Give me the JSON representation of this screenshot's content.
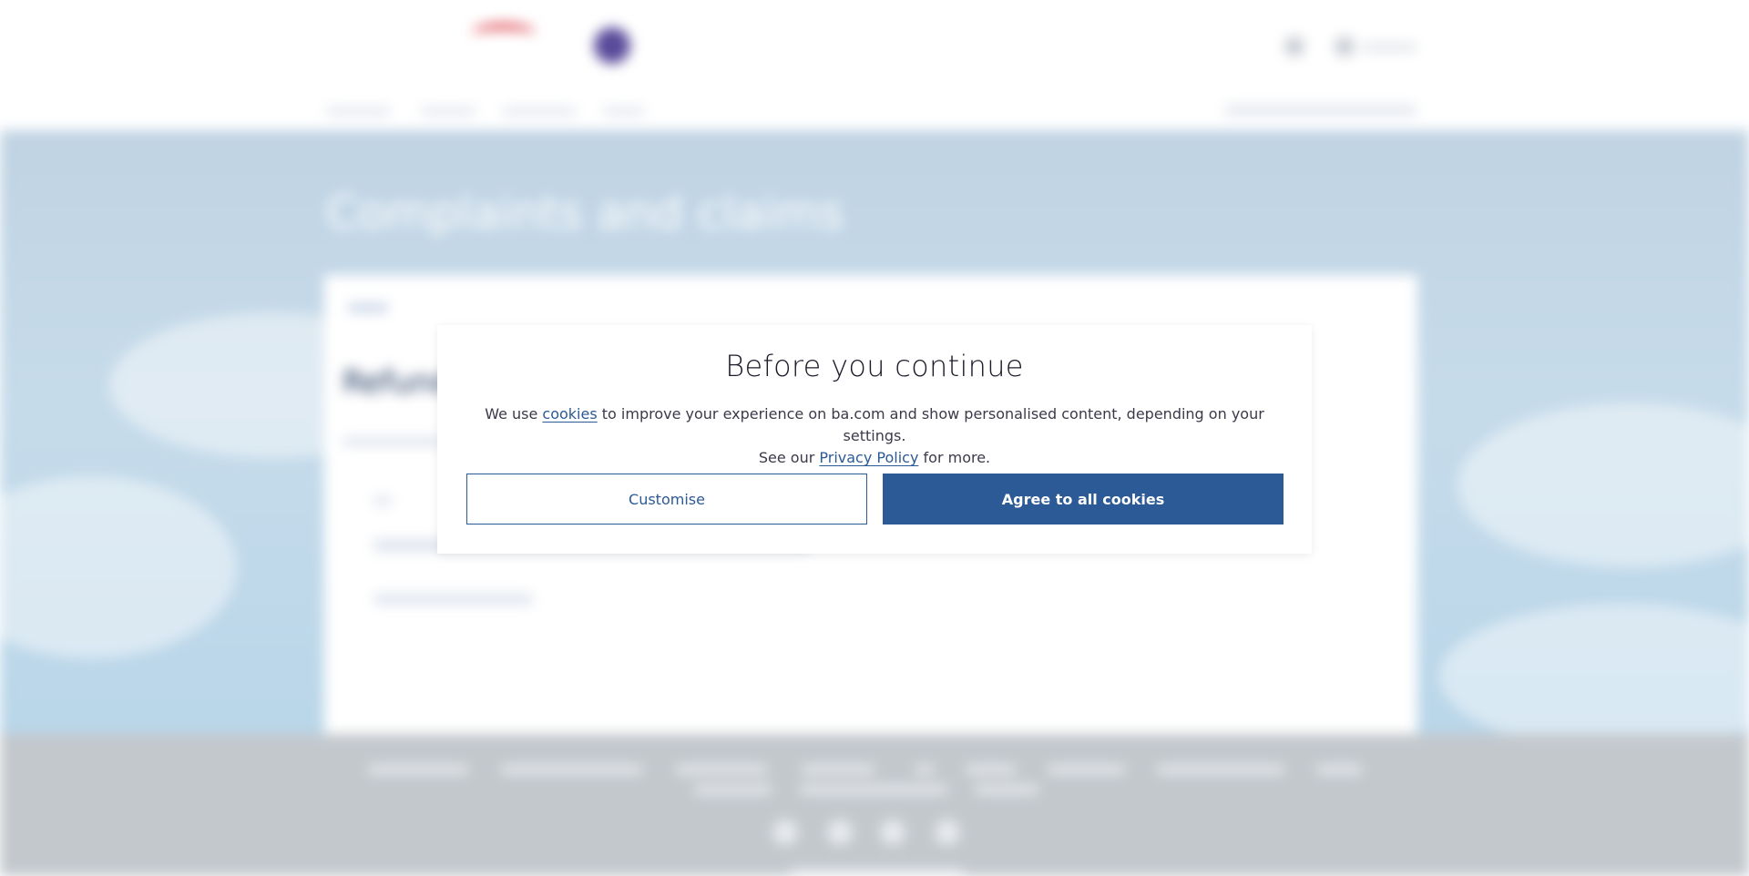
{
  "background_page": {
    "hero_title": "Complaints and claims",
    "card_heading": "Refund"
  },
  "cookie_modal": {
    "title": "Before you continue",
    "text_before_cookies": "We use ",
    "cookies_link": "cookies",
    "text_after_cookies": " to improve your experience on ba.com and show personalised content, depending on your settings.",
    "text_see_our": "See our ",
    "privacy_link": "Privacy Policy",
    "text_for_more": " for more.",
    "customise_label": "Customise",
    "agree_label": "Agree to all cookies"
  },
  "colors": {
    "primary": "#2b5a96",
    "hero_blue": "#c0d3e3",
    "footer_grey": "#c3c8cd"
  }
}
